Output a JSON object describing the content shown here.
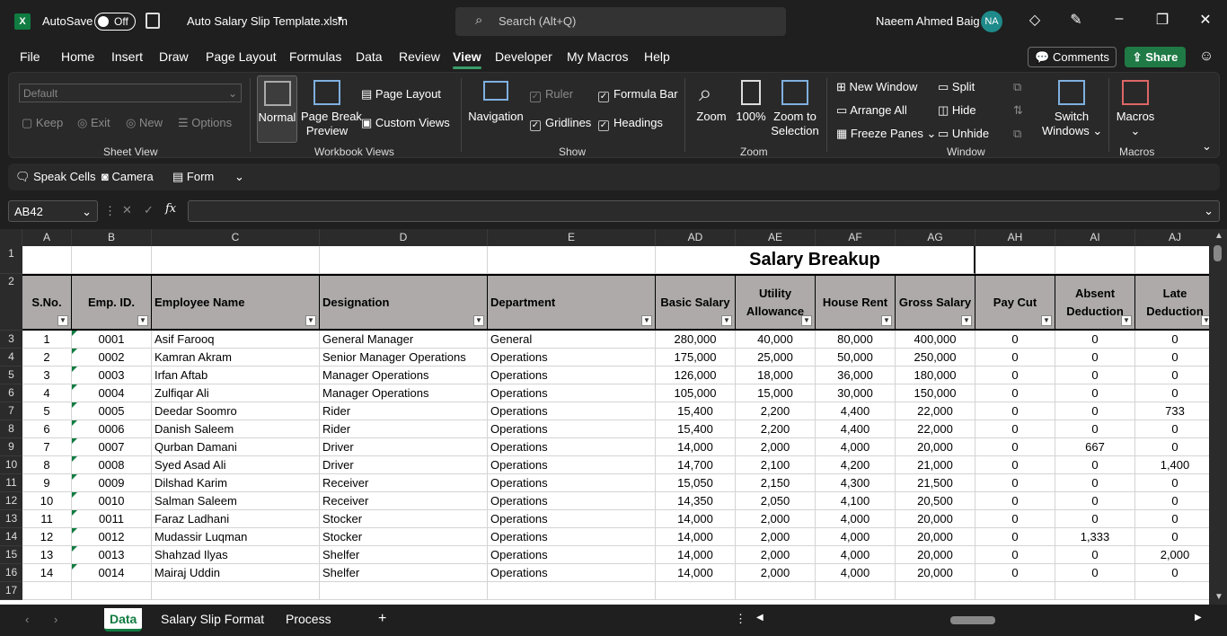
{
  "titlebar": {
    "app_icon": "excel-icon",
    "autosave_label": "AutoSave",
    "autosave_state": "Off",
    "file_name": "Auto Salary Slip Template.xlsm",
    "search_placeholder": "Search (Alt+Q)",
    "user_name": "Naeem Ahmed Baig",
    "user_initials": "NA"
  },
  "menu": [
    "File",
    "Home",
    "Insert",
    "Draw",
    "Page Layout",
    "Formulas",
    "Data",
    "Review",
    "View",
    "Developer",
    "My Macros",
    "Help"
  ],
  "menu_active": "View",
  "comments_label": "Comments",
  "share_label": "Share",
  "ribbon": {
    "sheet_view": {
      "dropdown": "Default",
      "keep": "Keep",
      "exit": "Exit",
      "new": "New",
      "options": "Options",
      "label": "Sheet View"
    },
    "workbook_views": {
      "normal": "Normal",
      "page_break": "Page Break",
      "preview": "Preview",
      "page_layout": "Page Layout",
      "custom_views": "Custom Views",
      "label": "Workbook Views"
    },
    "show": {
      "navigation": "Navigation",
      "ruler": "Ruler",
      "gridlines": "Gridlines",
      "formula_bar": "Formula Bar",
      "headings": "Headings",
      "label": "Show"
    },
    "zoom": {
      "zoom": "Zoom",
      "pct": "100%",
      "zoom_to": "Zoom to",
      "selection": "Selection",
      "label": "Zoom"
    },
    "window": {
      "new_window": "New Window",
      "arrange_all": "Arrange All",
      "freeze_panes": "Freeze Panes",
      "split": "Split",
      "hide": "Hide",
      "unhide": "Unhide",
      "switch": "Switch",
      "windows": "Windows",
      "label": "Window"
    },
    "macros": {
      "macros": "Macros",
      "label": "Macros"
    }
  },
  "qat": {
    "speak_cells": "Speak Cells",
    "camera": "Camera",
    "form": "Form"
  },
  "name_box": "AB42",
  "columns": [
    "A",
    "B",
    "C",
    "D",
    "E",
    "AD",
    "AE",
    "AF",
    "AG",
    "AH",
    "AI",
    "AJ"
  ],
  "title_cell": "Salary Breakup",
  "headers": [
    "S.No.",
    "Emp. ID.",
    "Employee Name",
    "Designation",
    "Department",
    "Basic Salary",
    "Utility Allowance",
    "House Rent",
    "Gross Salary",
    "Pay Cut",
    "Absent Deduction",
    "Late Deduction"
  ],
  "row_numbers": [
    "1",
    "2",
    "3",
    "4",
    "5",
    "6",
    "7",
    "8",
    "9",
    "10",
    "11",
    "12",
    "13",
    "14",
    "15",
    "16",
    "17"
  ],
  "rows": [
    [
      "1",
      "0001",
      "Asif Farooq",
      "General Manager",
      "General",
      "280,000",
      "40,000",
      "80,000",
      "400,000",
      "0",
      "0",
      "0"
    ],
    [
      "2",
      "0002",
      "Kamran Akram",
      "Senior Manager Operations",
      "Operations",
      "175,000",
      "25,000",
      "50,000",
      "250,000",
      "0",
      "0",
      "0"
    ],
    [
      "3",
      "0003",
      "Irfan Aftab",
      "Manager Operations",
      "Operations",
      "126,000",
      "18,000",
      "36,000",
      "180,000",
      "0",
      "0",
      "0"
    ],
    [
      "4",
      "0004",
      "Zulfiqar Ali",
      "Manager Operations",
      "Operations",
      "105,000",
      "15,000",
      "30,000",
      "150,000",
      "0",
      "0",
      "0"
    ],
    [
      "5",
      "0005",
      "Deedar Soomro",
      "Rider",
      "Operations",
      "15,400",
      "2,200",
      "4,400",
      "22,000",
      "0",
      "0",
      "733"
    ],
    [
      "6",
      "0006",
      "Danish Saleem",
      "Rider",
      "Operations",
      "15,400",
      "2,200",
      "4,400",
      "22,000",
      "0",
      "0",
      "0"
    ],
    [
      "7",
      "0007",
      "Qurban Damani",
      "Driver",
      "Operations",
      "14,000",
      "2,000",
      "4,000",
      "20,000",
      "0",
      "667",
      "0"
    ],
    [
      "8",
      "0008",
      "Syed Asad Ali",
      "Driver",
      "Operations",
      "14,700",
      "2,100",
      "4,200",
      "21,000",
      "0",
      "0",
      "1,400"
    ],
    [
      "9",
      "0009",
      "Dilshad Karim",
      "Receiver",
      "Operations",
      "15,050",
      "2,150",
      "4,300",
      "21,500",
      "0",
      "0",
      "0"
    ],
    [
      "10",
      "0010",
      "Salman Saleem",
      "Receiver",
      "Operations",
      "14,350",
      "2,050",
      "4,100",
      "20,500",
      "0",
      "0",
      "0"
    ],
    [
      "11",
      "0011",
      "Faraz Ladhani",
      "Stocker",
      "Operations",
      "14,000",
      "2,000",
      "4,000",
      "20,000",
      "0",
      "0",
      "0"
    ],
    [
      "12",
      "0012",
      "Mudassir Luqman",
      "Stocker",
      "Operations",
      "14,000",
      "2,000",
      "4,000",
      "20,000",
      "0",
      "1,333",
      "0"
    ],
    [
      "13",
      "0013",
      "Shahzad Ilyas",
      "Shelfer",
      "Operations",
      "14,000",
      "2,000",
      "4,000",
      "20,000",
      "0",
      "0",
      "2,000"
    ],
    [
      "14",
      "0014",
      "Mairaj Uddin",
      "Shelfer",
      "Operations",
      "14,000",
      "2,000",
      "4,000",
      "20,000",
      "0",
      "0",
      "0"
    ]
  ],
  "sheets": [
    "Data",
    "Salary Slip Format",
    "Process"
  ],
  "active_sheet": "Data"
}
